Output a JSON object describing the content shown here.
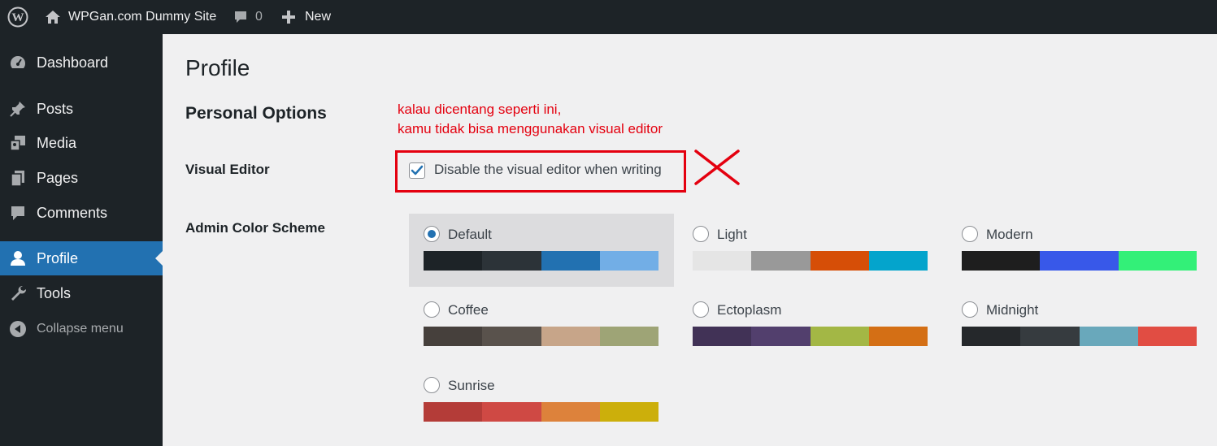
{
  "admin_bar": {
    "site_name": "WPGan.com Dummy Site",
    "comment_count": "0",
    "new_label": "New"
  },
  "sidebar": {
    "items": [
      {
        "label": "Dashboard",
        "icon": "dashboard-icon"
      },
      {
        "label": "Posts",
        "icon": "pin-icon"
      },
      {
        "label": "Media",
        "icon": "media-icon"
      },
      {
        "label": "Pages",
        "icon": "pages-icon"
      },
      {
        "label": "Comments",
        "icon": "comment-icon"
      },
      {
        "label": "Profile",
        "icon": "user-icon",
        "current": true
      },
      {
        "label": "Tools",
        "icon": "wrench-icon"
      },
      {
        "label": "Collapse menu",
        "icon": "collapse-arrow-icon"
      }
    ]
  },
  "page": {
    "title": "Profile",
    "section_title": "Personal Options",
    "visual_editor_label": "Visual Editor",
    "visual_editor_checkbox_label": "Disable the visual editor when writing",
    "visual_editor_checked": true,
    "admin_color_scheme_label": "Admin Color Scheme"
  },
  "annotation": {
    "line1": "kalau dicentang seperti ini,",
    "line2": "kamu tidak bisa menggunakan visual editor",
    "color": "#e4000f"
  },
  "color_schemes": [
    {
      "name": "Default",
      "selected": true,
      "colors": [
        "#1d2327",
        "#2c3338",
        "#2271b1",
        "#72aee6"
      ]
    },
    {
      "name": "Light",
      "selected": false,
      "colors": [
        "#e5e5e5",
        "#999999",
        "#d64e07",
        "#04a4cc"
      ]
    },
    {
      "name": "Modern",
      "selected": false,
      "colors": [
        "#1e1e1e",
        "#3858e9",
        "#33f078"
      ]
    },
    {
      "name": "Coffee",
      "selected": false,
      "colors": [
        "#46403c",
        "#59524c",
        "#c7a589",
        "#9ea476"
      ]
    },
    {
      "name": "Ectoplasm",
      "selected": false,
      "colors": [
        "#413256",
        "#523f6d",
        "#a3b745",
        "#d46f15"
      ]
    },
    {
      "name": "Midnight",
      "selected": false,
      "colors": [
        "#25282b",
        "#363b3f",
        "#69a8bb",
        "#e14d43"
      ]
    },
    {
      "name": "Sunrise",
      "selected": false,
      "colors": [
        "#b43c38",
        "#cf4944",
        "#dd823b",
        "#ccaf0b"
      ]
    }
  ]
}
